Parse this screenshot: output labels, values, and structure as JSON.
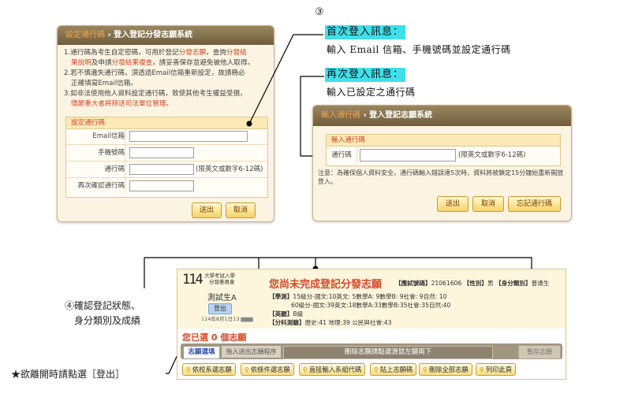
{
  "panel1": {
    "header_crumb": "設定通行碼",
    "header_title": "登入登記分發志願系統",
    "notes": [
      {
        "n": "1.",
        "a": "通行碼為考生自定密碼，可用於登記",
        "b": "分發志願",
        "c": "，查詢",
        "d": "分發結",
        "e": "果說明",
        "f": "及申請",
        "g": "分發結果複查",
        "h": "，請妥善保存並避免被他人取得。"
      },
      {
        "n": "2.",
        "a": "若不慎遺失通行碼，須透過Email信箱重新設定，故請務必",
        "b": "正確填寫Email信箱。"
      },
      {
        "n": "3.",
        "a": "如非法使用他人資料設定通行碼，致使其他考生權益受損，",
        "b": "情節重大者將移送司法單位管理。"
      }
    ],
    "form_title": "設定通行碼",
    "fields": [
      "Email信箱",
      "手機號碼",
      "通行碼",
      "再次確認通行碼"
    ],
    "password_hint": "(限英文或數字6-12碼)",
    "buttons": {
      "submit": "送出",
      "cancel": "取消"
    }
  },
  "callouts": {
    "num3": "③",
    "first_label": "首次登入訊息：",
    "first_text": "輸入 Email 信箱、手機號碼並設定通行碼",
    "again_label": "再次登入訊息：",
    "again_text": "輸入已設定之通行碼",
    "num4_line1": "④確認登記狀態、",
    "num4_line2": "身分類別及成績",
    "star_text": "★欲離開時請點選［登出］"
  },
  "panel2": {
    "header_crumb": "輸入通行碼",
    "header_title": "登入登記志願系統",
    "form_title": "輸入通行碼",
    "field": "通行碼",
    "hint": "(限英文或數字6-12碼)",
    "note": "注意：為確保個人資料安全，通行碼輸入錯誤達5次時，資料將被鎖定15分鐘始重新開放登入。",
    "buttons": {
      "submit": "送出",
      "cancel": "取消",
      "forgot": "忘記通行碼"
    }
  },
  "bottom": {
    "logo_num": "114",
    "logo_line1": "大學考試入學",
    "logo_line2": "分發委員會",
    "user_name": "測試生A",
    "logout": "登出",
    "timestamp": "114年8月1日13:",
    "status_title": "您尚未完成登記分發志願",
    "exam_label": "【應試號碼】",
    "exam_no": "21061606",
    "gender_label": "【性別】",
    "gender": "男",
    "identity_label": "【身分類別】",
    "identity": "普通生",
    "grade_label": "【學測】",
    "grade_line1": "15級分-國文:10英文: 5數學A: 9數學B: 9社會: 9自然: 10",
    "grade_line2": "60級分-國文:39英文:18數學A:33數學B:35社會:35自然:40",
    "english_label": "【英聽】",
    "english": "B級",
    "subject_label": "【分科測驗】",
    "subject": "歷史:41 地理:39 公民與社會:43",
    "selected_prefix": "您已選",
    "selected_count": "0",
    "selected_suffix": "個志願",
    "tab_active": "志願選填",
    "tab_inactive": "拖入送出志願程序",
    "drag_hint": "刪除志願請點選滑鼠左鍵兩下",
    "save_btn": "暫存志願",
    "actions": [
      "依校系選志願",
      "依條件選志願",
      "直接輸入系組代碼",
      "貼上志願碼",
      "刪除全部志願",
      "列印此頁"
    ]
  },
  "colors": {
    "accent": "#d2492a",
    "cyan": "#3fe0ea",
    "header": "#7a6846"
  }
}
